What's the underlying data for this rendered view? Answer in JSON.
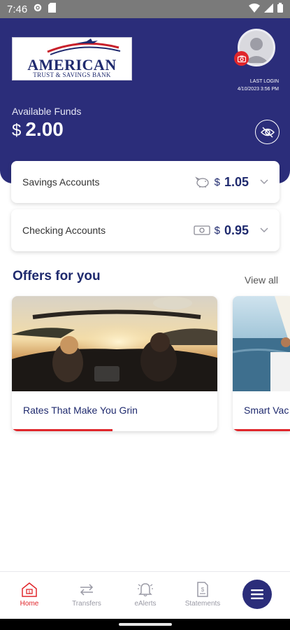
{
  "status_bar": {
    "time": "7:46"
  },
  "logo": {
    "name": "AMERICAN",
    "tagline": "TRUST & SAVINGS BANK"
  },
  "profile": {
    "last_login_label": "LAST LOGIN",
    "last_login_value": "4/10/2023 3:56 PM"
  },
  "funds": {
    "label": "Available Funds",
    "currency": "$",
    "amount": "2.00"
  },
  "accounts": [
    {
      "label": "Savings Accounts",
      "currency": "$",
      "amount": "1.05",
      "icon": "piggy-bank-icon"
    },
    {
      "label": "Checking Accounts",
      "currency": "$",
      "amount": "0.95",
      "icon": "cash-icon"
    }
  ],
  "offers": {
    "title": "Offers for you",
    "view_all": "View all",
    "items": [
      {
        "title": "Rates That Make You Grin",
        "progress": 0.49
      },
      {
        "title": "Smart Vac",
        "progress": 1.0
      }
    ]
  },
  "bottom_nav": {
    "items": [
      {
        "label": "Home",
        "icon": "home-icon",
        "active": true
      },
      {
        "label": "Transfers",
        "icon": "transfer-icon",
        "active": false
      },
      {
        "label": "eAlerts",
        "icon": "bell-icon",
        "active": false
      },
      {
        "label": "Statements",
        "icon": "statement-icon",
        "active": false
      }
    ],
    "menu_icon": "menu-icon"
  },
  "colors": {
    "brand_navy": "#2b2d7a",
    "accent_red": "#e0262b"
  }
}
